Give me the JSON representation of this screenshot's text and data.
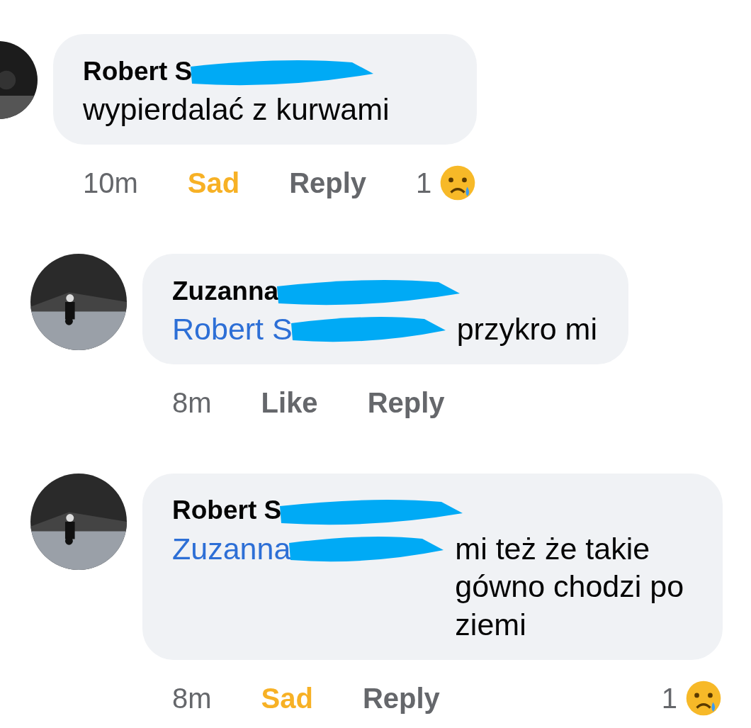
{
  "comments": [
    {
      "author": "Robert S",
      "text": "wypierdalać z kurwami",
      "time": "10m",
      "reaction_label": "Sad",
      "reacted": true,
      "reply_label": "Reply",
      "reaction_count": "1",
      "replies": [
        {
          "author": "Zuzanna",
          "mention": "Robert S",
          "text": "przykro mi",
          "time": "8m",
          "reaction_label": "Like",
          "reacted": false,
          "reply_label": "Reply"
        },
        {
          "author": "Robert S",
          "mention": "Zuzanna",
          "text": "mi też że takie gówno chodzi po ziemi",
          "time": "8m",
          "reaction_label": "Sad",
          "reacted": true,
          "reply_label": "Reply",
          "reaction_count": "1"
        }
      ]
    }
  ]
}
